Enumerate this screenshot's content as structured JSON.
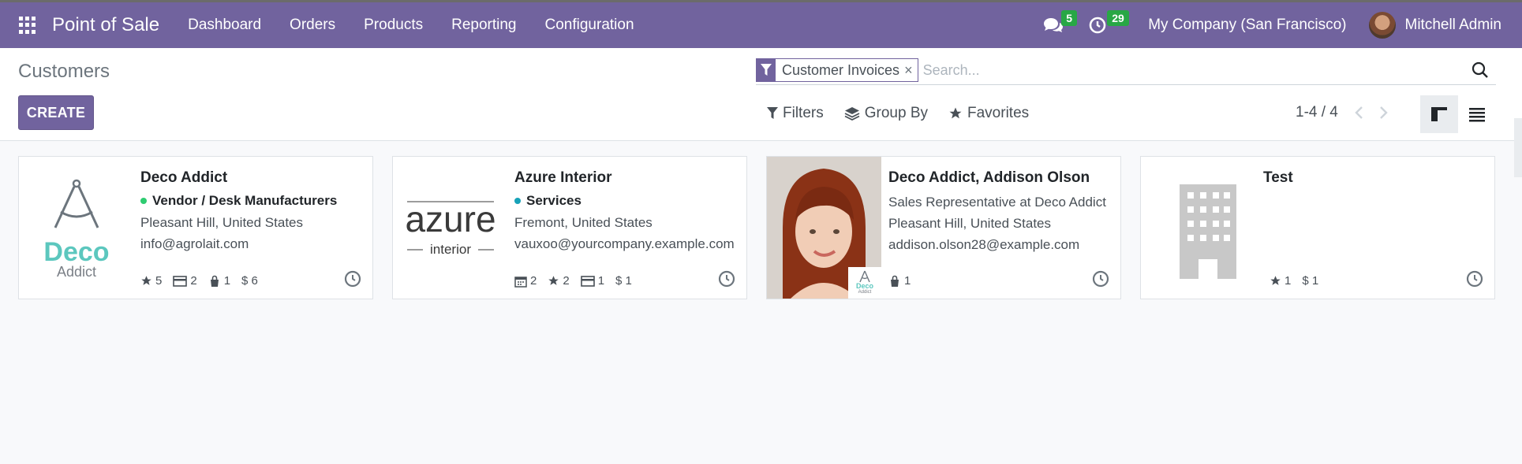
{
  "navbar": {
    "app_name": "Point of Sale",
    "menu": [
      "Dashboard",
      "Orders",
      "Products",
      "Reporting",
      "Configuration"
    ],
    "messages_count": "5",
    "activities_count": "29",
    "company": "My Company (San Francisco)",
    "user": "Mitchell Admin"
  },
  "control_panel": {
    "title": "Customers",
    "create_label": "CREATE",
    "facet": "Customer Invoices",
    "facet_remove": "×",
    "search_placeholder": "Search...",
    "filters_label": "Filters",
    "groupby_label": "Group By",
    "favorites_label": "Favorites",
    "pager": "1-4 / 4"
  },
  "cards": [
    {
      "name": "Deco Addict",
      "tag": "Vendor / Desk Manufacturers",
      "tag_color": "#2ecc71",
      "lines": [
        "Pleasant Hill, United States",
        "info@agrolait.com"
      ],
      "logo_text_1": "Deco",
      "logo_text_2": "Addict",
      "stats": [
        "5",
        "2",
        "1",
        "$ 6"
      ]
    },
    {
      "name": "Azure Interior",
      "tag": "Services",
      "tag_color": "#17a2b8",
      "lines": [
        "Fremont, United States",
        "vauxoo@yourcompany.example.com"
      ],
      "logo_text_1": "azure",
      "logo_text_2": "interior",
      "stats": [
        "2",
        "2",
        "1",
        "$ 1"
      ]
    },
    {
      "name": "Deco Addict, Addison Olson",
      "lines": [
        "Sales Representative at Deco Addict",
        "Pleasant Hill, United States",
        "addison.olson28@example.com"
      ],
      "mini_logo_1": "Deco",
      "mini_logo_2": "Addict",
      "stats": [
        "1"
      ]
    },
    {
      "name": "Test",
      "stats": [
        "1",
        "$ 1"
      ]
    }
  ],
  "colors": {
    "brand": "#71639e",
    "badge": "#28a745"
  }
}
